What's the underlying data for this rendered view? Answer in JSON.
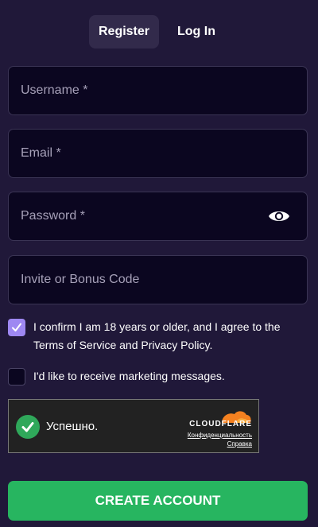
{
  "tabs": {
    "register": "Register",
    "login": "Log In"
  },
  "fields": {
    "username": {
      "placeholder": "Username *",
      "value": ""
    },
    "email": {
      "placeholder": "Email *",
      "value": ""
    },
    "password": {
      "placeholder": "Password *",
      "value": ""
    },
    "invite": {
      "placeholder": "Invite or Bonus Code",
      "value": ""
    }
  },
  "checkboxes": {
    "confirm": {
      "checked": true,
      "label": "I confirm I am 18 years or older, and I agree to the Terms of Service and Privacy Policy."
    },
    "marketing": {
      "checked": false,
      "label": "I'd like to receive marketing messages."
    }
  },
  "captcha": {
    "status": "Успешно.",
    "brand": "CLOUDFLARE",
    "privacy_link": "Конфиденциальность",
    "help_link": "Справка"
  },
  "submit_label": "CREATE ACCOUNT",
  "colors": {
    "background": "#201839",
    "field_bg": "#0b0620",
    "accent_purple": "#9e88f2",
    "button_green": "#27b560",
    "cloudflare_orange": "#f48120"
  },
  "icons": {
    "password_toggle": "eye-icon",
    "captcha_status": "check-circle-icon",
    "captcha_logo": "cloudflare-logo"
  }
}
